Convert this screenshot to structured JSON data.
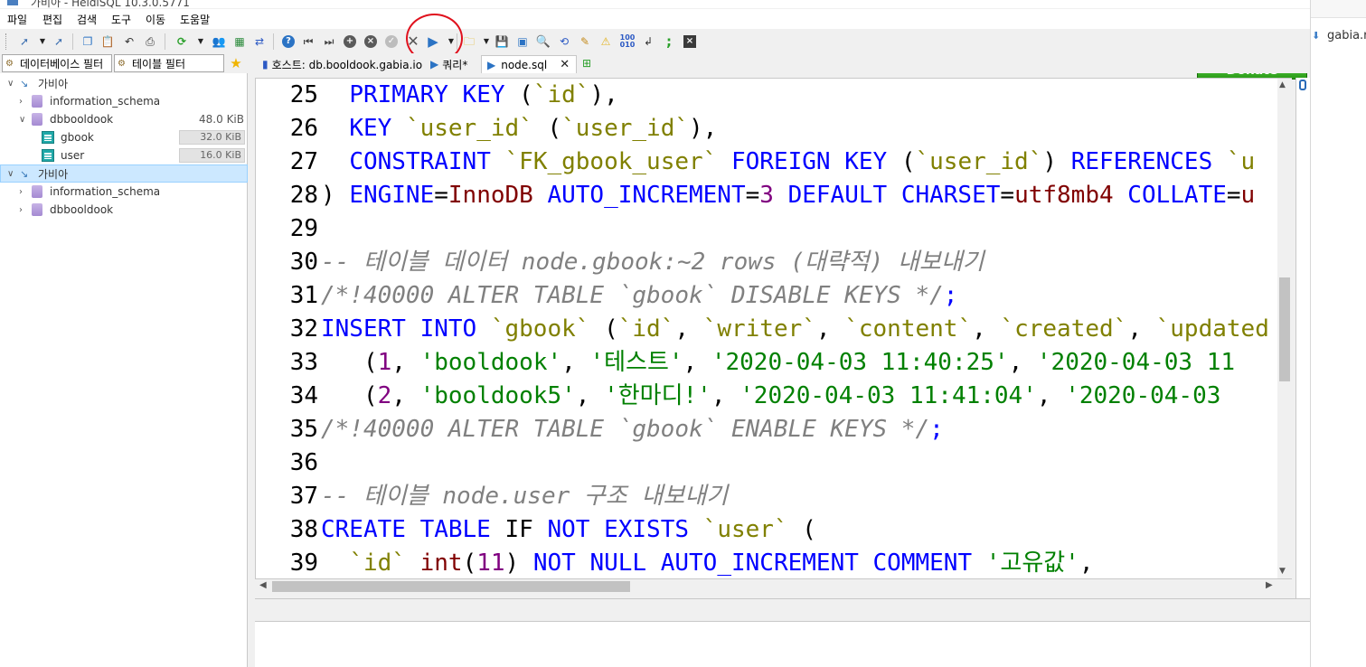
{
  "window": {
    "title": "가비아 - HeidiSQL 10.3.0.5771"
  },
  "menu": [
    "파일",
    "편집",
    "검색",
    "도구",
    "이동",
    "도움말"
  ],
  "toolbar": {
    "donate_label": "Donate",
    "number_toggle_glyph": "100\n010",
    "semicolon_glyph": ";"
  },
  "filters": {
    "database_filter": "데이터베이스 필터",
    "table_filter": "테이블 필터"
  },
  "tabs": [
    {
      "label": "호스트: db.booldook.gabia.io"
    },
    {
      "label": "쿼리*"
    },
    {
      "label": "node.sql"
    }
  ],
  "tree": {
    "sessions": [
      {
        "name": "가비아",
        "databases": [
          {
            "name": "information_schema",
            "size": ""
          },
          {
            "name": "dbbooldook",
            "size": "48.0 KiB",
            "tables": [
              {
                "name": "gbook",
                "size": "32.0 KiB"
              },
              {
                "name": "user",
                "size": "16.0 KiB"
              }
            ]
          }
        ]
      },
      {
        "name": "가비아",
        "databases": [
          {
            "name": "information_schema"
          },
          {
            "name": "dbbooldook"
          }
        ]
      }
    ]
  },
  "editor": {
    "lines": [
      {
        "n": "25",
        "tokens": [
          [
            "p",
            "  "
          ],
          [
            "k",
            "PRIMARY KEY"
          ],
          [
            "p",
            " ("
          ],
          [
            "b",
            "`id`"
          ],
          [
            "p",
            "),"
          ]
        ]
      },
      {
        "n": "26",
        "tokens": [
          [
            "p",
            "  "
          ],
          [
            "k",
            "KEY"
          ],
          [
            "p",
            " "
          ],
          [
            "b",
            "`user_id`"
          ],
          [
            "p",
            " ("
          ],
          [
            "b",
            "`user_id`"
          ],
          [
            "p",
            "),"
          ]
        ]
      },
      {
        "n": "27",
        "tokens": [
          [
            "p",
            "  "
          ],
          [
            "k",
            "CONSTRAINT"
          ],
          [
            "p",
            " "
          ],
          [
            "b",
            "`FK_gbook_user`"
          ],
          [
            "p",
            " "
          ],
          [
            "k",
            "FOREIGN KEY"
          ],
          [
            "p",
            " ("
          ],
          [
            "b",
            "`user_id`"
          ],
          [
            "p",
            ") "
          ],
          [
            "k",
            "REFERENCES"
          ],
          [
            "p",
            " "
          ],
          [
            "b",
            "`u"
          ]
        ]
      },
      {
        "n": "28",
        "tokens": [
          [
            "p",
            ") "
          ],
          [
            "k",
            "ENGINE"
          ],
          [
            "p",
            "="
          ],
          [
            "e",
            "InnoDB"
          ],
          [
            "p",
            " "
          ],
          [
            "k",
            "AUTO_INCREMENT"
          ],
          [
            "p",
            "="
          ],
          [
            "n",
            "3"
          ],
          [
            "p",
            " "
          ],
          [
            "k",
            "DEFAULT CHARSET"
          ],
          [
            "p",
            "="
          ],
          [
            "e",
            "utf8mb4"
          ],
          [
            "p",
            " "
          ],
          [
            "k",
            "COLLATE"
          ],
          [
            "p",
            "="
          ],
          [
            "e",
            "u"
          ]
        ]
      },
      {
        "n": "29",
        "tokens": []
      },
      {
        "n": "30",
        "tokens": [
          [
            "c",
            "-- 테이블 데이터 node.gbook:~2 rows (대략적) 내보내기"
          ]
        ]
      },
      {
        "n": "31",
        "tokens": [
          [
            "c",
            "/*!40000 ALTER TABLE `gbook` DISABLE KEYS */"
          ],
          [
            "k",
            ";"
          ]
        ]
      },
      {
        "n": "32",
        "tokens": [
          [
            "k",
            "INSERT INTO"
          ],
          [
            "p",
            " "
          ],
          [
            "b",
            "`gbook`"
          ],
          [
            "p",
            " ("
          ],
          [
            "b",
            "`id`"
          ],
          [
            "p",
            ", "
          ],
          [
            "b",
            "`writer`"
          ],
          [
            "p",
            ", "
          ],
          [
            "b",
            "`content`"
          ],
          [
            "p",
            ", "
          ],
          [
            "b",
            "`created`"
          ],
          [
            "p",
            ", "
          ],
          [
            "b",
            "`updated"
          ]
        ]
      },
      {
        "n": "33",
        "tokens": [
          [
            "p",
            "   ("
          ],
          [
            "n",
            "1"
          ],
          [
            "p",
            ", "
          ],
          [
            "s",
            "'booldook'"
          ],
          [
            "p",
            ", "
          ],
          [
            "s",
            "'테스트'"
          ],
          [
            "p",
            ", "
          ],
          [
            "s",
            "'2020-04-03 11:40:25'"
          ],
          [
            "p",
            ", "
          ],
          [
            "s",
            "'2020-04-03 11"
          ]
        ]
      },
      {
        "n": "34",
        "tokens": [
          [
            "p",
            "   ("
          ],
          [
            "n",
            "2"
          ],
          [
            "p",
            ", "
          ],
          [
            "s",
            "'booldook5'"
          ],
          [
            "p",
            ", "
          ],
          [
            "s",
            "'한마디!'"
          ],
          [
            "p",
            ", "
          ],
          [
            "s",
            "'2020-04-03 11:41:04'"
          ],
          [
            "p",
            ", "
          ],
          [
            "s",
            "'2020-04-03"
          ]
        ]
      },
      {
        "n": "35",
        "tokens": [
          [
            "c",
            "/*!40000 ALTER TABLE `gbook` ENABLE KEYS */"
          ],
          [
            "k",
            ";"
          ]
        ]
      },
      {
        "n": "36",
        "tokens": []
      },
      {
        "n": "37",
        "tokens": [
          [
            "c",
            "-- 테이블 node.user 구조 내보내기"
          ]
        ]
      },
      {
        "n": "38",
        "tokens": [
          [
            "k",
            "CREATE TABLE"
          ],
          [
            "p",
            " IF "
          ],
          [
            "k",
            "NOT EXISTS"
          ],
          [
            "p",
            " "
          ],
          [
            "b",
            "`user`"
          ],
          [
            "p",
            " ("
          ]
        ]
      },
      {
        "n": "39",
        "tokens": [
          [
            "p",
            "  "
          ],
          [
            "b",
            "`id`"
          ],
          [
            "p",
            " "
          ],
          [
            "e",
            "int"
          ],
          [
            "p",
            "("
          ],
          [
            "n",
            "11"
          ],
          [
            "p",
            ") "
          ],
          [
            "k",
            "NOT NULL AUTO_INCREMENT COMMENT"
          ],
          [
            "p",
            " "
          ],
          [
            "s",
            "'고유값'"
          ],
          [
            "p",
            ","
          ]
        ]
      }
    ]
  },
  "side_window": {
    "text": "gabia.r"
  },
  "colors": {
    "keyword": "#0000ff",
    "backtick": "#808000",
    "number": "#800080",
    "string": "#008000",
    "comment": "#808080",
    "engine": "#800000",
    "donate": "#3fb52a",
    "highlight_circle": "#e0111d",
    "selection": "#cce8ff"
  }
}
